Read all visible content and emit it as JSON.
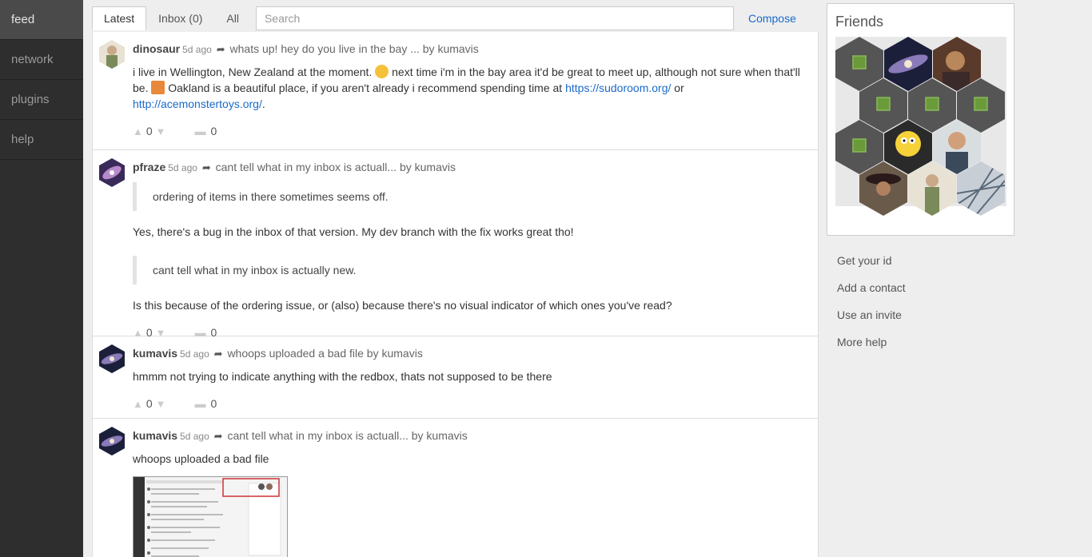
{
  "sidebar": {
    "items": [
      {
        "label": "feed"
      },
      {
        "label": "network"
      },
      {
        "label": "plugins"
      },
      {
        "label": "help"
      }
    ]
  },
  "tabs": [
    {
      "label": "Latest"
    },
    {
      "label": "Inbox (0)"
    },
    {
      "label": "All"
    }
  ],
  "search": {
    "placeholder": "Search"
  },
  "compose_label": "Compose",
  "posts": [
    {
      "author": "dinosaur",
      "ago": "5d ago",
      "subject": "whats up! hey do you live in the bay ... by kumavis",
      "body_1": "i live in Wellington, New Zealand at the moment.",
      "body_2": "next time i'm in the bay area it'd be great to meet up, although not sure when that'll be.",
      "body_3": "Oakland is a beautiful place, if you aren't already i recommend spending time at",
      "link_1": "https://sudoroom.org/",
      "body_or": "or",
      "link_2": "http://acemonstertoys.org/",
      "body_end": ".",
      "votes": "0",
      "comments": "0"
    },
    {
      "author": "pfraze",
      "ago": "5d ago",
      "subject": "cant tell what in my inbox is actuall... by kumavis",
      "quote_1": "ordering of items in there sometimes seems off.",
      "para_1": "Yes, there's a bug in the inbox of that version. My dev branch with the fix works great tho!",
      "quote_2": "cant tell what in my inbox is actually new.",
      "para_2": "Is this because of the ordering issue, or (also) because there's no visual indicator of which ones you've read?",
      "votes": "0",
      "comments": "0"
    },
    {
      "author": "kumavis",
      "ago": "5d ago",
      "subject": "whoops uploaded a bad file by kumavis",
      "body": "hmmm not trying to indicate anything with the redbox, thats not supposed to be there",
      "votes": "0",
      "comments": "0"
    },
    {
      "author": "kumavis",
      "ago": "5d ago",
      "subject": "cant tell what in my inbox is actuall... by kumavis",
      "body": "whoops uploaded a bad file"
    }
  ],
  "friends": {
    "title": "Friends"
  },
  "help_links": [
    {
      "label": "Get your id"
    },
    {
      "label": "Add a contact"
    },
    {
      "label": "Use an invite"
    },
    {
      "label": "More help"
    }
  ],
  "colors": {
    "sidebar": "#2e2e2e",
    "link": "#1a6ac9",
    "hex_default": "#555555",
    "hex_cube": "#6a9a3a"
  }
}
